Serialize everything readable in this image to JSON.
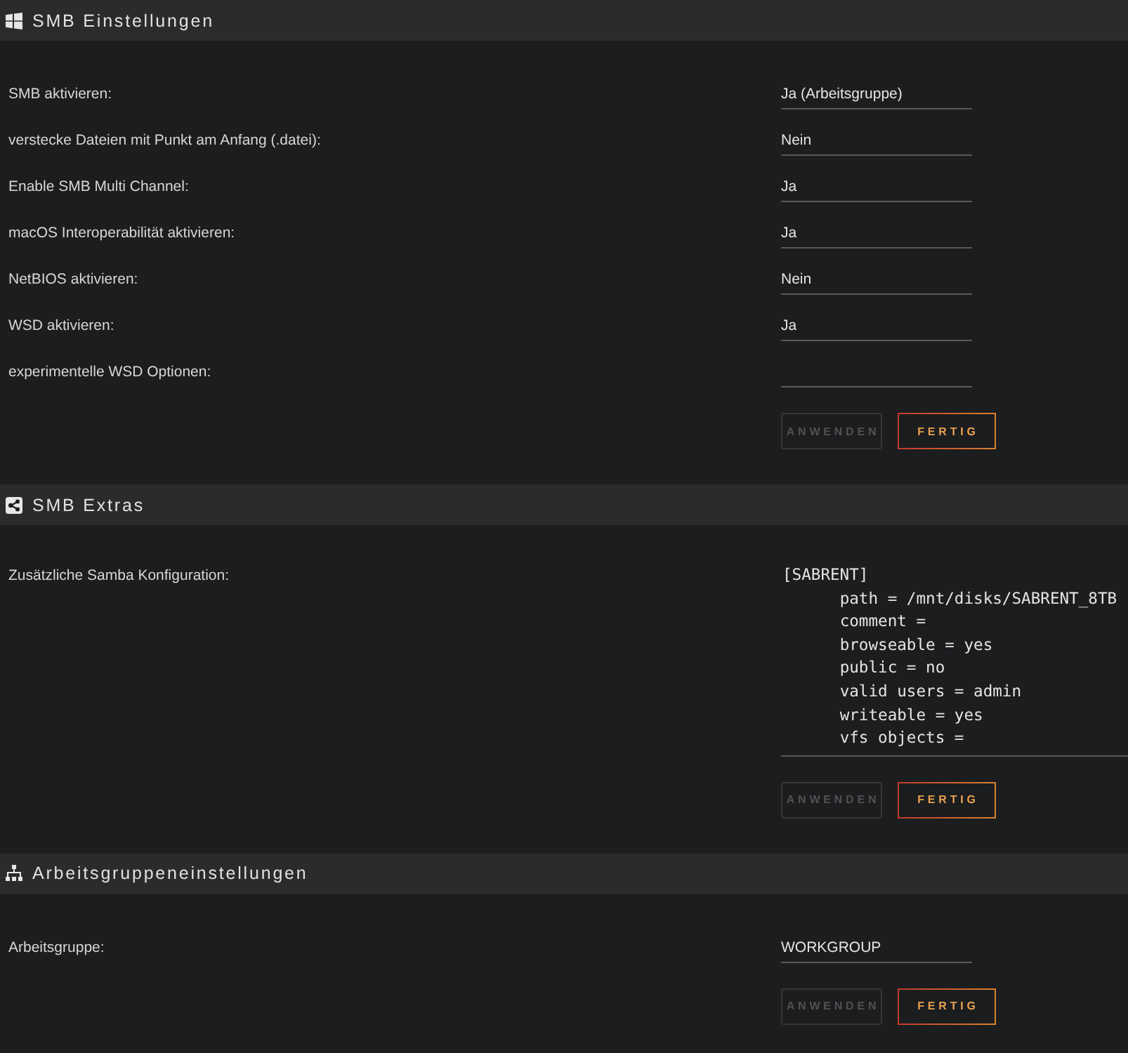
{
  "sections": [
    {
      "title": "SMB Einstellungen",
      "fields": [
        {
          "label": "SMB aktivieren:",
          "kind": "select",
          "value": "Ja (Arbeitsgruppe)"
        },
        {
          "label": "verstecke Dateien mit Punkt am Anfang (.datei):",
          "kind": "select",
          "value": "Nein"
        },
        {
          "label": "Enable SMB Multi Channel:",
          "kind": "select",
          "value": "Ja"
        },
        {
          "label": "macOS Interoperabilität aktivieren:",
          "kind": "select",
          "value": "Ja"
        },
        {
          "label": "NetBIOS aktivieren:",
          "kind": "select",
          "value": "Nein"
        },
        {
          "label": "WSD aktivieren:",
          "kind": "select",
          "value": "Ja"
        },
        {
          "label": "experimentelle WSD Optionen:",
          "kind": "input"
        }
      ],
      "buttons": [
        {
          "label": "ANWENDEN",
          "disabled": true
        },
        {
          "label": "FERTIG",
          "disabled": false
        }
      ]
    },
    {
      "title": "SMB Extras",
      "fields": [
        {
          "label": "Zusätzliche Samba Konfiguration:",
          "kind": "textarea",
          "value": "[SABRENT]\n\tpath = /mnt/disks/SABRENT_8TB\n\tcomment =\n\tbrowseable = yes\n\tpublic = no\n\tvalid users = admin\n\twriteable = yes\n\tvfs objects ="
        }
      ],
      "buttons": [
        {
          "label": "ANWENDEN",
          "disabled": true
        },
        {
          "label": "FERTIG",
          "disabled": false
        }
      ]
    },
    {
      "title": "Arbeitsgruppeneinstellungen",
      "fields": [
        {
          "label": "Arbeitsgruppe:",
          "kind": "input",
          "value": "WORKGROUP"
        }
      ],
      "buttons": [
        {
          "label": "ANWENDEN",
          "disabled": true
        },
        {
          "label": "FERTIG",
          "disabled": false
        }
      ]
    }
  ]
}
